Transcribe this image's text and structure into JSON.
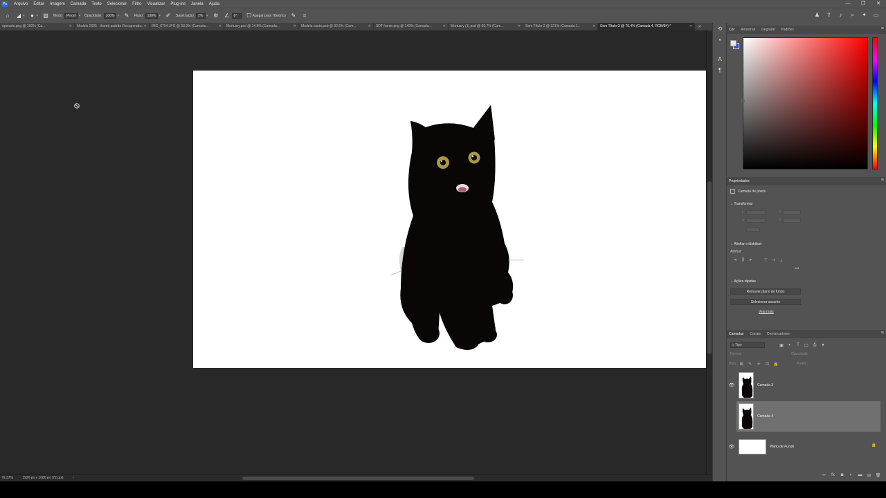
{
  "menu": {
    "items": [
      "Arquivo",
      "Editar",
      "Imagem",
      "Camada",
      "Texto",
      "Selecionar",
      "Filtro",
      "Visualizar",
      "Plug-ins",
      "Janela",
      "Ajuda"
    ]
  },
  "window_controls": [
    "—",
    "❐",
    "✕"
  ],
  "options": {
    "mode_label": "Modo:",
    "mode_value": "Pincel",
    "opacity_label": "Opacidade:",
    "opacity_value": "100%",
    "flow_label": "Fluxo:",
    "flow_value": "100%",
    "smoothing_label": "Suavização:",
    "smoothing_value": "2%",
    "angle_value": "0°",
    "erase_history_label": "Apagar para Histórico"
  },
  "tabs": [
    {
      "label": "uperado.png @ 100% (Ca...",
      "active": false
    },
    {
      "label": "Modelo 2025 - thumb padrão-Recuperado.psd",
      "active": false
    },
    {
      "label": "IMG_0704.JPG @ 93,9% (Camada...",
      "active": false
    },
    {
      "label": "Mortuary.psd @ 14,8% (Camada...",
      "active": false
    },
    {
      "label": "Modelo canto.psb @ 92,6% (Cam...",
      "active": false
    },
    {
      "label": "SDT fronte.png @ 149% (Camada...",
      "active": false
    },
    {
      "label": "Mortuary (1).psd @ 60,7% (Cam...",
      "active": false
    },
    {
      "label": "Sem Título-2 @ 121% (Camada 1...",
      "active": false
    },
    {
      "label": "Sem Título-3 @ 79,4% (Camada 4, RGB/8#) *",
      "active": true
    }
  ],
  "status": {
    "zoom": "79,37%",
    "doc_size": "1920 px x 1080 px (72 ppi)"
  },
  "color_panel": {
    "tabs": [
      "Cor",
      "Amostras",
      "Degradê",
      "Padrões"
    ],
    "active_tab": "Cor",
    "foreground": "#e8e8e8",
    "background": "#2b4fd8"
  },
  "properties": {
    "title": "Propriedades",
    "subtitle": "Camada de pixels",
    "transform_label": "Transformar",
    "transform_fields": [
      "L",
      "A",
      "X",
      "Y"
    ],
    "align_label": "Alinhar e distribuir",
    "align_sub": "Alinhar:",
    "quick_label": "Ações rápidas",
    "remove_bg": "Remover plano de fundo",
    "select_subject": "Selecionar assunto",
    "view_more": "Veja mais"
  },
  "layers_panel": {
    "tabs": [
      "Camadas",
      "Canais",
      "Demarcadores"
    ],
    "active_tab": "Camadas",
    "filter_label": "Tipo",
    "blend_mode": "Normal",
    "opacity_label": "Opacidade:",
    "lock_label": "Bloq.:",
    "fill_label": "Preen.:",
    "layers": [
      {
        "name": "Camada 3",
        "visible": true,
        "selected": false
      },
      {
        "name": "Camada 4",
        "visible": false,
        "selected": true
      },
      {
        "name": "Plano de Fundo",
        "visible": true,
        "selected": false,
        "locked": true
      }
    ]
  },
  "icons": {
    "cursor": "brush-cursor-icon",
    "eye": "eye-icon",
    "lock": "lock-icon"
  }
}
